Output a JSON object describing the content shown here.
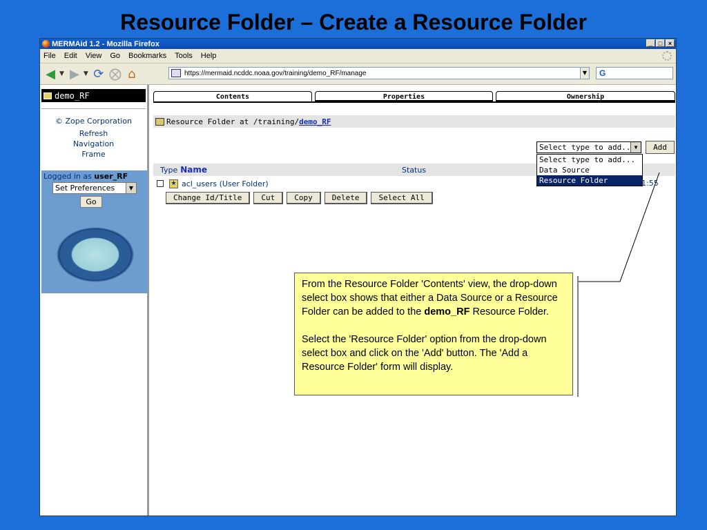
{
  "slide": {
    "title": "Resource Folder – Create a Resource Folder"
  },
  "window": {
    "title": "MERMAid 1.2 - Mozilla Firefox"
  },
  "menu": {
    "items": [
      "File",
      "Edit",
      "View",
      "Go",
      "Bookmarks",
      "Tools",
      "Help"
    ]
  },
  "navigation": {
    "url": "https://mermaid.ncddc.noaa.gov/training/demo_RF/manage",
    "search_label": "G"
  },
  "left_frame": {
    "folder_name": "demo_RF",
    "copyright": "© Zope Corporation",
    "refresh_line1": "Refresh",
    "refresh_line2": "Navigation",
    "refresh_line3": "Frame",
    "logged_in_prefix": "Logged in as",
    "logged_in_user": "user_RF",
    "preferences_select": "Set Preferences",
    "go_label": "Go"
  },
  "tabs": [
    {
      "label": "Contents",
      "active": true
    },
    {
      "label": "Properties",
      "active": false
    },
    {
      "label": "Ownership",
      "active": false
    }
  ],
  "folder_header": {
    "prefix": "Resource Folder at",
    "path": "/training/",
    "link": "demo_RF"
  },
  "add_control": {
    "selected": "Select type to add...",
    "add_label": "Add",
    "options": [
      "Select type to add...",
      "Data Source",
      "Resource Folder"
    ],
    "highlighted": "Resource Folder"
  },
  "list_header": {
    "type": "Type",
    "name": "Name",
    "status": "Status"
  },
  "rows": [
    {
      "name": "acl_users (User Folder)",
      "date_fragment": "1:55"
    }
  ],
  "actions": [
    "Change Id/Title",
    "Cut",
    "Copy",
    "Delete",
    "Select All"
  ],
  "callout": {
    "p1_start": "From the Resource Folder  'Contents' view, the drop-down select box shows that either a Data Source or a Resource Folder can be added to the ",
    "p1_bold": "demo_RF",
    "p1_end": " Resource Folder.",
    "p2": "Select the 'Resource Folder' option from the drop-down select box and click on the 'Add' button. The 'Add a Resource Folder' form will display."
  },
  "colors": {
    "slide_bg": "#1c6ed8",
    "highlight": "#0a246a",
    "callout_bg": "#ffff99"
  }
}
